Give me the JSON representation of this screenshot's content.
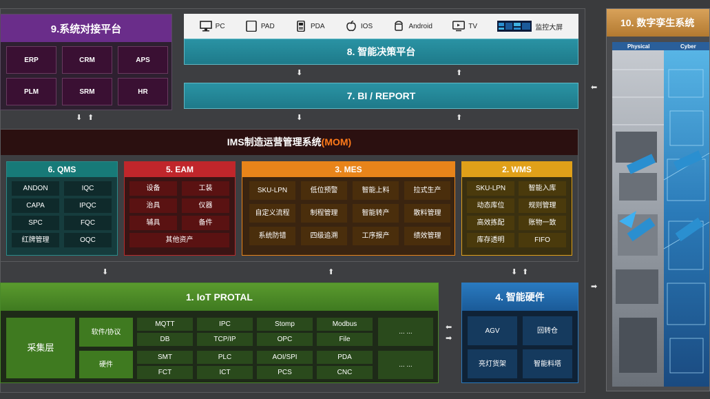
{
  "sys": {
    "title": "9.系统对接平台",
    "items": [
      "ERP",
      "CRM",
      "APS",
      "PLM",
      "SRM",
      "HR"
    ]
  },
  "devices": {
    "items": [
      "PC",
      "PAD",
      "PDA",
      "IOS",
      "Android",
      "TV",
      "监控大屏"
    ]
  },
  "decision": {
    "title": "8. 智能决策平台"
  },
  "bi": {
    "title": "7. BI / REPORT"
  },
  "mom": {
    "title_main": "IMS制造运营管理系统",
    "title_accent": "(MOM)"
  },
  "qms": {
    "title": "6. QMS",
    "items": [
      "ANDON",
      "IQC",
      "CAPA",
      "IPQC",
      "SPC",
      "FQC",
      "红牌管理",
      "OQC"
    ]
  },
  "eam": {
    "title": "5. EAM",
    "items": [
      "设备",
      "工装",
      "治具",
      "仪器",
      "辅具",
      "备件"
    ],
    "wide": "其他资产"
  },
  "mes": {
    "title": "3. MES",
    "items": [
      "SKU-LPN",
      "低位预警",
      "智能上料",
      "拉式生产",
      "自定义流程",
      "制程管理",
      "智能转产",
      "散料管理",
      "系统防错",
      "四级追溯",
      "工序报产",
      "绩效管理"
    ]
  },
  "wms": {
    "title": "2. WMS",
    "items": [
      "SKU-LPN",
      "智能入库",
      "动态库位",
      "规则管理",
      "高效拣配",
      "账物一致",
      "库存透明",
      "FIFO"
    ]
  },
  "iot": {
    "title": "1. IoT PROTAL",
    "layer": "采集层",
    "software": "软件/协议",
    "hardware": "硬件",
    "soft_items": [
      "MQTT",
      "IPC",
      "Stomp",
      "Modbus",
      "DB",
      "TCP/IP",
      "OPC",
      "File"
    ],
    "hard_items": [
      "SMT",
      "PLC",
      "AOI/SPI",
      "PDA",
      "FCT",
      "ICT",
      "PCS",
      "CNC"
    ],
    "more": "... ..."
  },
  "hw": {
    "title": "4. 智能硬件",
    "items": [
      "AGV",
      "回转仓",
      "亮灯货架",
      "智能料塔"
    ]
  },
  "twin": {
    "title": "10. 数字孪生系统",
    "physical": "Physical",
    "cyber": "Cyber"
  },
  "colors": {
    "purple": "#6a2d8a",
    "teal": "#2a8a99",
    "green": "#4a8a2a",
    "red": "#c0262b",
    "orange": "#e8841a",
    "yellow": "#e0a019",
    "blue": "#1f6fb0",
    "accent": "#ff7a1a"
  }
}
